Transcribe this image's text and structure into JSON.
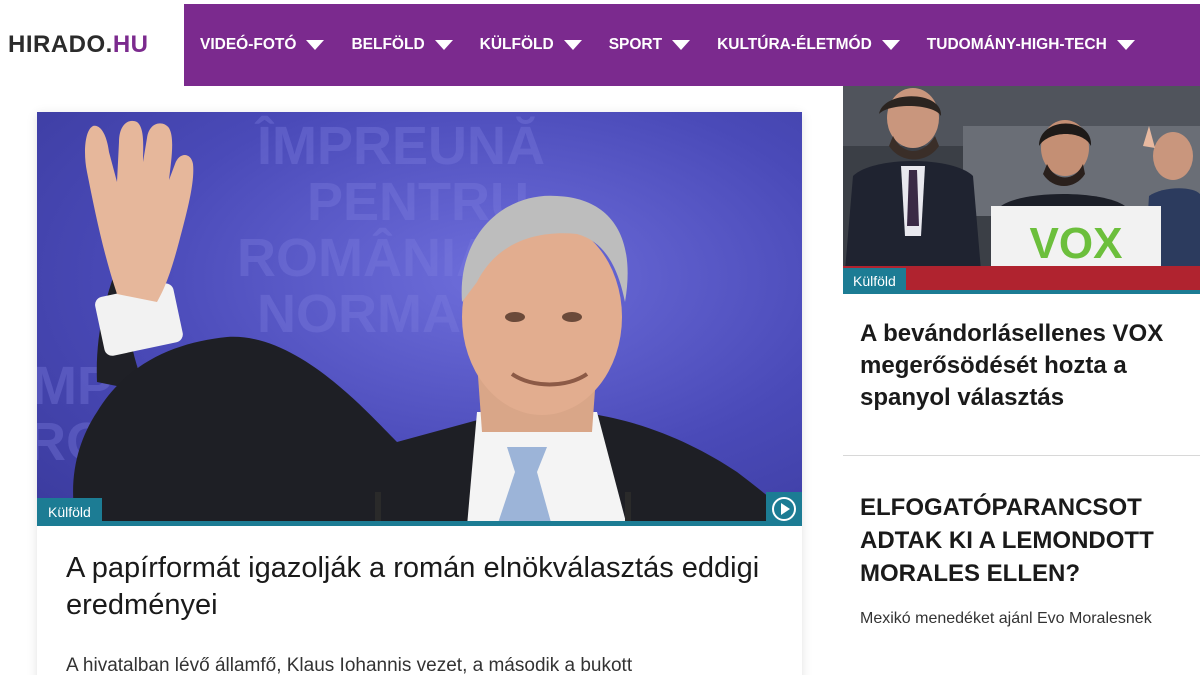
{
  "site": {
    "logo_main": "HIRADO.",
    "logo_suffix": "HU"
  },
  "nav": {
    "items": [
      {
        "label": "VIDEÓ-FOTÓ"
      },
      {
        "label": "BELFÖLD"
      },
      {
        "label": "KÜLFÖLD"
      },
      {
        "label": "SPORT"
      },
      {
        "label": "KULTÚRA-ÉLETMÓD"
      },
      {
        "label": "TUDOMÁNY-HIGH-TECH"
      }
    ]
  },
  "main_article": {
    "category": "Külföld",
    "title": "A papírformát igazolják a román elnökválasztás eddigi eredményei",
    "lead": "A hivatalban lévő államfő, Klaus Iohannis vezet, a második a bukott",
    "image_bg_text": "ÎMPREUNĂ PENTRU ROMÂNIA NORMALĂ"
  },
  "side_articles": [
    {
      "category": "Külföld",
      "title": "A bevándorlásellenes VOX megerősödését hozta a spanyol választás",
      "image_sign_text": "VOX"
    },
    {
      "title": "ELFOGATÓPARANCSOT ADTAK KI A LEMONDOTT MORALES ELLEN?",
      "lead": "Mexikó menedéket ajánl Evo Moralesnek"
    }
  ],
  "colors": {
    "brand_purple": "#7b2a8e",
    "badge_teal": "#1c7c94",
    "vox_green": "#6cbf3c"
  },
  "icons": [
    "chevron-down-icon",
    "play-icon"
  ]
}
